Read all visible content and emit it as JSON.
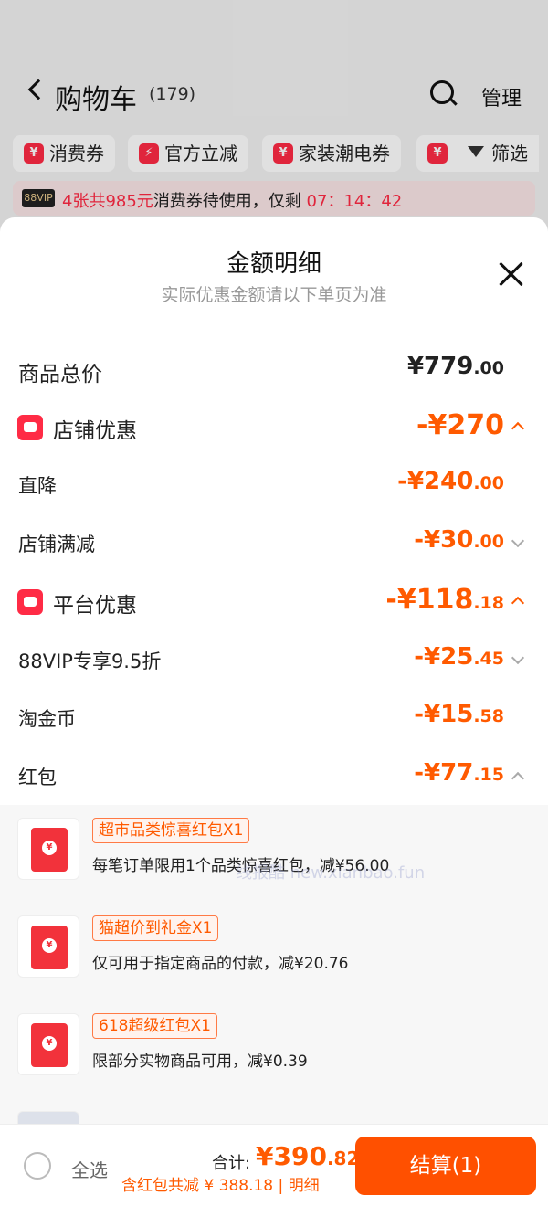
{
  "header": {
    "title": "购物车",
    "count": "(179)",
    "manage_label": "管理"
  },
  "chips": [
    {
      "label": "消费券"
    },
    {
      "label": "官方立减"
    },
    {
      "label": "家装潮电券"
    }
  ],
  "filter_label": "筛选",
  "vip_banner": {
    "badge": "88VIP",
    "highlight": "4张共985元",
    "text": "消费券待使用，仅剩",
    "countdown": "07：14：42"
  },
  "sheet": {
    "title": "金额明细",
    "subtitle": "实际优惠金额请以下单页为准",
    "rows": [
      {
        "label": "商品总价",
        "int": "¥779",
        "dec": ".00"
      },
      {
        "label": "店铺优惠",
        "int": "-¥270",
        "dec": ""
      },
      {
        "label": "直降",
        "int": "-¥240",
        "dec": ".00"
      },
      {
        "label": "店铺满减",
        "int": "-¥30",
        "dec": ".00"
      },
      {
        "label": "平台优惠",
        "int": "-¥118",
        "dec": ".18"
      },
      {
        "label": "88VIP专享9.5折",
        "int": "-¥25",
        "dec": ".45"
      },
      {
        "label": "淘金币",
        "int": "-¥15",
        "dec": ".58"
      },
      {
        "label": "红包",
        "int": "-¥77",
        "dec": ".15"
      }
    ],
    "packets": [
      {
        "tag": "超市品类惊喜红包X1",
        "desc": "每笔订单限用1个品类惊喜红包，减¥56.00"
      },
      {
        "tag": "猫超价到礼金X1",
        "desc": "仅可用于指定商品的付款，减¥20.76"
      },
      {
        "tag": "618超级红包X1",
        "desc": "限部分实物商品可用，减¥0.39"
      }
    ],
    "watermark": "线报酷 new.xianbao.fun"
  },
  "footer": {
    "select_all": "全选",
    "total_label": "合计:",
    "total_int": "¥390",
    "total_dec": ".82",
    "discount_line": "含红包共减 ¥ 388.18 | 明细",
    "checkout_label": "结算(1)"
  },
  "colors": {
    "accent": "#ff5000",
    "red": "#ff2b45"
  }
}
